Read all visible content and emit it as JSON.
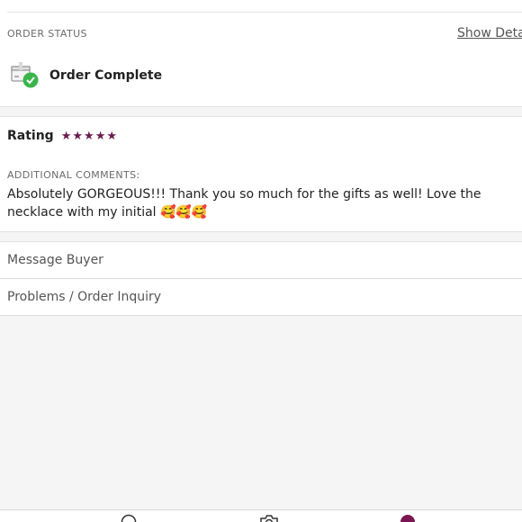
{
  "order_status": {
    "label": "ORDER STATUS",
    "show_details_label": "Show Details",
    "status_text": "Order Complete",
    "status_icon": "package-check-icon"
  },
  "rating": {
    "label": "Rating",
    "stars": 5,
    "max_stars": 5,
    "star_color": "#6b1a4e"
  },
  "comments": {
    "label": "ADDITIONAL COMMENTS:",
    "text": "Absolutely GORGEOUS!!! Thank you so much for the gifts as well! Love the necklace with my initial 🥰🥰🥰"
  },
  "actions": {
    "message_buyer": "Message Buyer",
    "problems": "Problems / Order Inquiry"
  },
  "tab_bar": {
    "icons": [
      "search-icon",
      "camera-icon",
      "profile-icon"
    ],
    "active_color": "#7a1453"
  }
}
